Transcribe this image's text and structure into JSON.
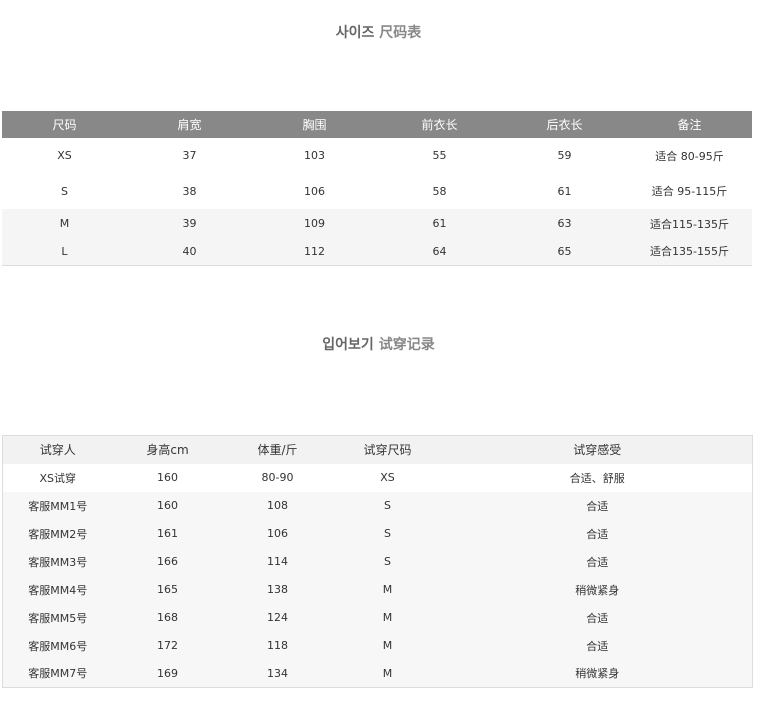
{
  "size_section": {
    "title_ko": "사이즈",
    "title_zh": "尺码表",
    "headers": [
      "尺码",
      "肩宽",
      "胸围",
      "前衣长",
      "后衣长",
      "备注"
    ],
    "rows": [
      [
        "XS",
        "37",
        "103",
        "55",
        "59",
        "适合 80-95斤"
      ],
      [
        "S",
        "38",
        "106",
        "58",
        "61",
        "适合 95-115斤"
      ],
      [
        "M",
        "39",
        "109",
        "61",
        "63",
        "适合115-135斤"
      ],
      [
        "L",
        "40",
        "112",
        "64",
        "65",
        "适合135-155斤"
      ]
    ]
  },
  "try_section": {
    "title_ko": "입어보기",
    "title_zh": "试穿记录",
    "headers": [
      "试穿人",
      "身高cm",
      "体重/斤",
      "试穿尺码",
      "试穿感受"
    ],
    "rows": [
      [
        "XS试穿",
        "160",
        "80-90",
        "XS",
        "合适、舒服"
      ],
      [
        "客服MM1号",
        "160",
        "108",
        "S",
        "合适"
      ],
      [
        "客服MM2号",
        "161",
        "106",
        "S",
        "合适"
      ],
      [
        "客服MM3号",
        "166",
        "114",
        "S",
        "合适"
      ],
      [
        "客服MM4号",
        "165",
        "138",
        "M",
        "稍微紧身"
      ],
      [
        "客服MM5号",
        "168",
        "124",
        "M",
        "合适"
      ],
      [
        "客服MM6号",
        "172",
        "118",
        "M",
        "合适"
      ],
      [
        "客服MM7号",
        "169",
        "134",
        "M",
        "稍微紧身"
      ]
    ]
  }
}
